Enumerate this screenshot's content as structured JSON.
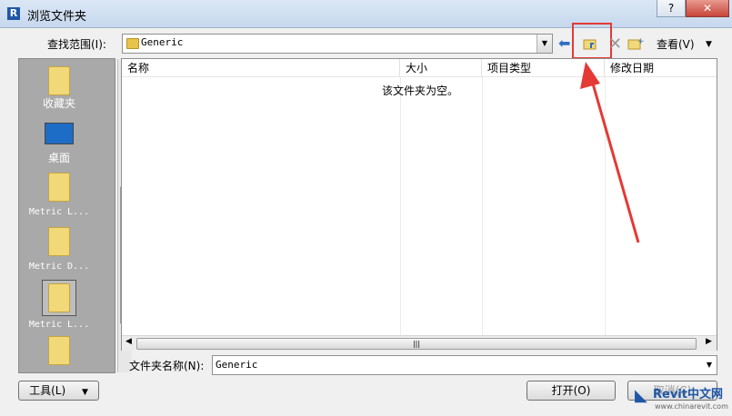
{
  "window": {
    "app_letter": "R",
    "title": "浏览文件夹",
    "help_label": "?",
    "close_label": "✕"
  },
  "toolbar": {
    "look_in_label": "查找范围(I):",
    "look_in_value": "Generic",
    "views_label": "查看(V)",
    "views_arrow": "▼",
    "back_icon": "back-arrow-icon",
    "up_icon": "up-one-level-folder-icon",
    "delete_icon": "delete-x-icon",
    "newfolder_icon": "new-folder-icon"
  },
  "places": [
    {
      "label": "收藏夹",
      "icon": "favorites-folder-icon"
    },
    {
      "label": "桌面",
      "icon": "desktop-icon"
    },
    {
      "label": "Metric L...",
      "icon": "folder-icon"
    },
    {
      "label": "Metric D...",
      "icon": "folder-icon"
    },
    {
      "label": "Metric L...",
      "icon": "folder-icon"
    }
  ],
  "filelist": {
    "columns": [
      "名称",
      "大小",
      "项目类型",
      "修改日期"
    ],
    "empty_message": "该文件夹为空。"
  },
  "folder_name": {
    "label": "文件夹名称(N):",
    "value": "Generic"
  },
  "buttons": {
    "tools": "工具(L)",
    "tools_arrow": "▼",
    "open": "打开(O)",
    "cancel": "取消(C)"
  },
  "watermark": {
    "name": "Revit中文网",
    "url": "www.chinarevit.com"
  },
  "colors": {
    "highlight": "#e53935",
    "accent": "#1f57a6"
  }
}
